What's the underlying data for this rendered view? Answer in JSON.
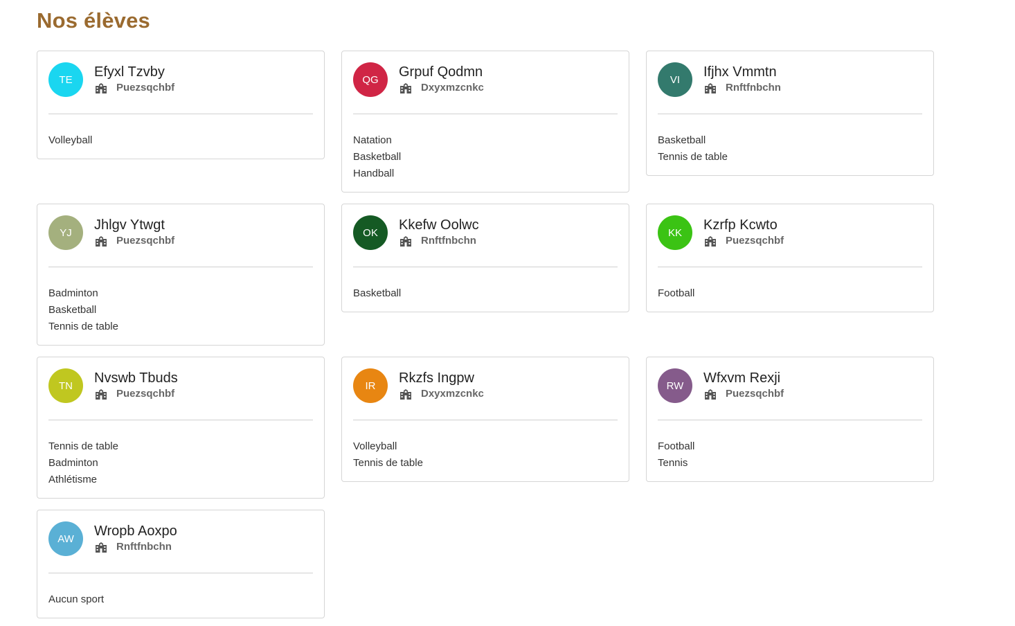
{
  "page": {
    "title": "Nos élèves"
  },
  "students": [
    {
      "initials": "TE",
      "name": "Efyxl Tzvby",
      "school": "Puezsqchbf",
      "avatar_color": "#1ad6f0",
      "sports": [
        "Volleyball"
      ]
    },
    {
      "initials": "QG",
      "name": "Grpuf Qodmn",
      "school": "Dxyxmzcnkc",
      "avatar_color": "#d02545",
      "sports": [
        "Natation",
        "Basketball",
        "Handball"
      ]
    },
    {
      "initials": "VI",
      "name": "Ifjhx Vmmtn",
      "school": "Rnftfnbchn",
      "avatar_color": "#337a6d",
      "sports": [
        "Basketball",
        "Tennis de table"
      ]
    },
    {
      "initials": "YJ",
      "name": "Jhlgv Ytwgt",
      "school": "Puezsqchbf",
      "avatar_color": "#a4b07e",
      "sports": [
        "Badminton",
        "Basketball",
        "Tennis de table"
      ]
    },
    {
      "initials": "OK",
      "name": "Kkefw Oolwc",
      "school": "Rnftfnbchn",
      "avatar_color": "#155a24",
      "sports": [
        "Basketball"
      ]
    },
    {
      "initials": "KK",
      "name": "Kzrfp Kcwto",
      "school": "Puezsqchbf",
      "avatar_color": "#3bc314",
      "sports": [
        "Football"
      ]
    },
    {
      "initials": "TN",
      "name": "Nvswb Tbuds",
      "school": "Puezsqchbf",
      "avatar_color": "#c0c720",
      "sports": [
        "Tennis de table",
        "Badminton",
        "Athlétisme"
      ]
    },
    {
      "initials": "IR",
      "name": "Rkzfs Ingpw",
      "school": "Dxyxmzcnkc",
      "avatar_color": "#e88612",
      "sports": [
        "Volleyball",
        "Tennis de table"
      ]
    },
    {
      "initials": "RW",
      "name": "Wfxvm Rexji",
      "school": "Puezsqchbf",
      "avatar_color": "#855b8b",
      "sports": [
        "Football",
        "Tennis"
      ]
    },
    {
      "initials": "AW",
      "name": "Wropb Aoxpo",
      "school": "Rnftfnbchn",
      "avatar_color": "#5ab0d5",
      "sports": [
        "Aucun sport"
      ]
    }
  ],
  "icons": {
    "school": "school-building-icon"
  }
}
